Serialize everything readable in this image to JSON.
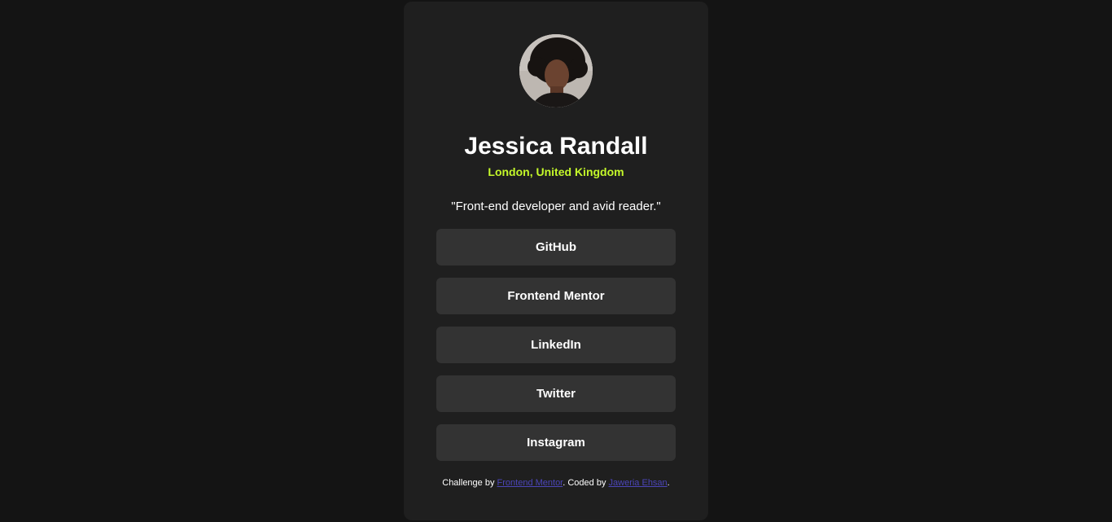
{
  "profile": {
    "name": "Jessica Randall",
    "location": "London, United Kingdom",
    "bio": "\"Front-end developer and avid reader.\""
  },
  "links": [
    {
      "label": "GitHub"
    },
    {
      "label": "Frontend Mentor"
    },
    {
      "label": "LinkedIn"
    },
    {
      "label": "Twitter"
    },
    {
      "label": "Instagram"
    }
  ],
  "attribution": {
    "prefix": "Challenge by",
    "challenge_link": "Frontend Mentor",
    "middle": ". Coded by",
    "author_link": "Jaweria Ehsan",
    "suffix": "."
  },
  "colors": {
    "page_background": "#141414",
    "card_background": "#1f1f1f",
    "button_background": "#333333",
    "accent_green": "#c4f82a",
    "link_color": "#4b45b8"
  }
}
